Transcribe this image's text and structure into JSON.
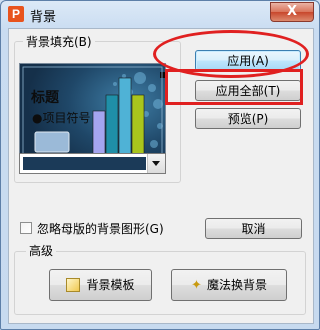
{
  "window": {
    "title": "背景",
    "app_icon": "P",
    "close_glyph": "X"
  },
  "background_fill": {
    "legend": "背景填充(B)",
    "preview": {
      "heading": "标题",
      "bullet_text": "●项目符号"
    }
  },
  "buttons": {
    "apply": "应用(A)",
    "apply_all": "应用全部(T)",
    "preview": "预览(P)",
    "cancel": "取消",
    "bg_template": "背景模板",
    "magic_bg": "魔法换背景"
  },
  "omit_master_checkbox": {
    "label": "忽略母版的背景图形(G)",
    "checked": false
  },
  "advanced": {
    "legend": "高级"
  },
  "highlight_color": "#e02020"
}
